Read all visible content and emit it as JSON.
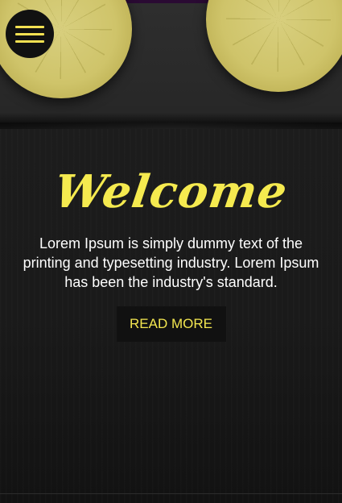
{
  "nav": {
    "menu_icon": "hamburger-menu-icon"
  },
  "hero": {
    "title": "Welcome",
    "text": "Lorem Ipsum is simply dummy text of the printing and typesetting industry. Lorem Ipsum has been the industry's standard.",
    "button_label": "READ MORE"
  },
  "colors": {
    "accent": "#f5ea4f",
    "background": "#1c1c1c",
    "button_bg": "#111111",
    "text": "#ffffff"
  }
}
